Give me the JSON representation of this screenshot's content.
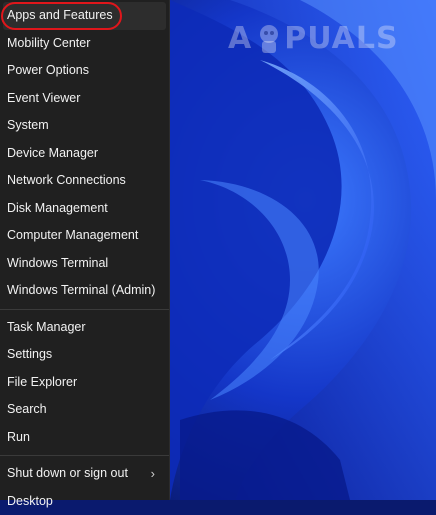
{
  "watermark": {
    "text_left": "A",
    "text_right": "PUALS"
  },
  "menu": {
    "group1": [
      "Apps and Features",
      "Mobility Center",
      "Power Options",
      "Event Viewer",
      "System",
      "Device Manager",
      "Network Connections",
      "Disk Management",
      "Computer Management",
      "Windows Terminal",
      "Windows Terminal (Admin)"
    ],
    "group2": [
      "Task Manager",
      "Settings",
      "File Explorer",
      "Search",
      "Run"
    ],
    "group3": [
      "Shut down or sign out",
      "Desktop"
    ]
  },
  "colors": {
    "menu_bg": "#202020",
    "highlight_ring": "#e0161b",
    "wallpaper": "#0b3ad6"
  }
}
